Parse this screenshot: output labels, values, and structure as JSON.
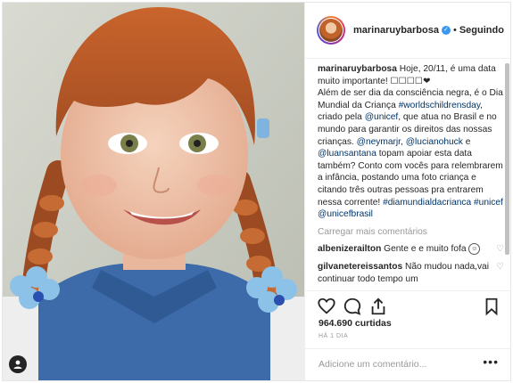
{
  "header": {
    "username": "marinaruybarbosa",
    "verified_mark": "✓",
    "separator": "•",
    "follow_status": "Seguindo"
  },
  "caption": {
    "username": "marinaruybarbosa",
    "p1": "Hoje, 20/11, é uma data muito importante! ☐☐☐☐❤",
    "p2": "Além de ser dia da consciência negra, é o Dia Mundial da Criança",
    "h1": "#worldschildrensday",
    "p3": ", criado pela",
    "m1": "@unicef",
    "p4": ", que atua no Brasil e no mundo para garantir os direitos das nossas crianças.",
    "m2": "@neymarjr",
    "p5": ",",
    "m3": "@lucianohuck",
    "p6": "e",
    "m4": "@luansantana",
    "p7": "topam apoiar esta data também? Conto com vocês para relembrarem a infância, postando uma foto criança e citando três outras pessoas pra entrarem nessa corrente!",
    "h2": "#diamundialdacrianca",
    "h3": "#unicef",
    "m5": "@unicefbrasil"
  },
  "load_more": "Carregar mais comentários",
  "comments": [
    {
      "username": "albenizerailton",
      "text": "Gente e e muito fofa",
      "emoji": "☺"
    },
    {
      "username": "gilvanetereissantos",
      "text": "Não mudou nada,vai continuar todo tempo um"
    }
  ],
  "likes_text": "964.690 curtidas",
  "time_ago": "HÁ 1 DIA",
  "add_comment_placeholder": "Adicione um comentário...",
  "more_options": "•••",
  "icons": {
    "like": "heart-icon",
    "comment": "comment-icon",
    "share": "share-icon",
    "save": "bookmark-icon",
    "tag": "user-tag-icon"
  },
  "colors": {
    "link": "#003569",
    "verified": "#3897f0",
    "muted": "#999999"
  }
}
